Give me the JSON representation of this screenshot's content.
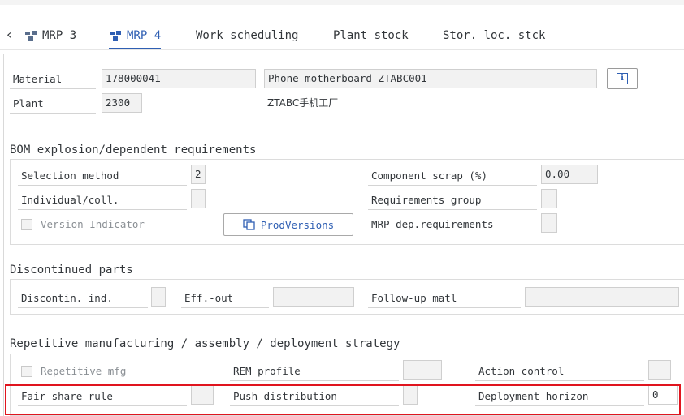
{
  "tabs": [
    {
      "label": "MRP 3"
    },
    {
      "label": "MRP 4"
    },
    {
      "label": "Work scheduling"
    },
    {
      "label": "Plant stock"
    },
    {
      "label": "Stor. loc. stck"
    }
  ],
  "header": {
    "material_label": "Material",
    "material_value": "178000041",
    "material_desc": "Phone motherboard ZTABC001",
    "plant_label": "Plant",
    "plant_value": "2300",
    "plant_desc": "ZTABC手机工厂"
  },
  "bom": {
    "title": "BOM explosion/dependent requirements",
    "selection_method_label": "Selection method",
    "selection_method_value": "2",
    "individual_coll_label": "Individual/coll.",
    "individual_coll_value": "",
    "version_indicator_label": "Version Indicator",
    "prodversions_label": "ProdVersions",
    "component_scrap_label": "Component scrap (%)",
    "component_scrap_value": "0.00",
    "requirements_group_label": "Requirements group",
    "requirements_group_value": "",
    "mrp_dep_req_label": "MRP dep.requirements",
    "mrp_dep_req_value": ""
  },
  "discontinued": {
    "title": "Discontinued parts",
    "discontin_ind_label": "Discontin. ind.",
    "discontin_ind_value": "",
    "eff_out_label": "Eff.-out",
    "eff_out_value": "",
    "followup_label": "Follow-up matl",
    "followup_value": ""
  },
  "repetitive": {
    "title": "Repetitive manufacturing / assembly / deployment strategy",
    "repetitive_mfg_label": "Repetitive mfg",
    "rem_profile_label": "REM profile",
    "rem_profile_value": "",
    "action_control_label": "Action control",
    "action_control_value": "",
    "fair_share_label": "Fair share rule",
    "fair_share_value": "",
    "push_dist_label": "Push distribution",
    "push_dist_value": "",
    "deploy_horizon_label": "Deployment horizon",
    "deploy_horizon_value": "0"
  },
  "colors": {
    "accent": "#2f5fb3",
    "highlight": "#e0141e"
  }
}
